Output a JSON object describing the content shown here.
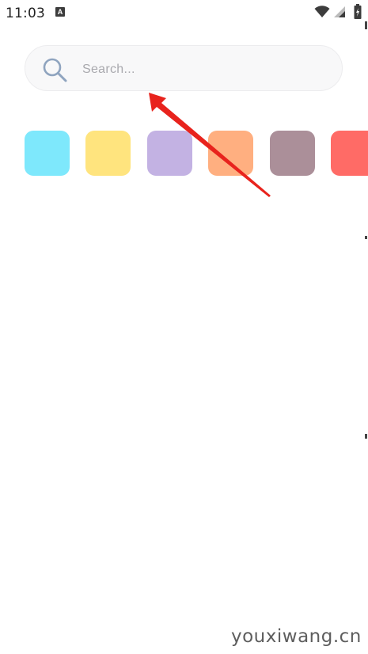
{
  "status_bar": {
    "time": "11:03",
    "notification_badge": "A",
    "icons": [
      "notification-a-icon",
      "wifi-icon",
      "signal-icon",
      "battery-icon"
    ]
  },
  "search": {
    "placeholder": "Search...",
    "value": "",
    "icon": "search-icon",
    "icon_color": "#8fa4bf"
  },
  "swatches": {
    "colors": [
      "#7ee8fc",
      "#ffe47e",
      "#c3b2e3",
      "#ffaf80",
      "#ab8f99",
      "#ff6b66"
    ]
  },
  "annotation": {
    "color": "#e8231d",
    "icon": "red-arrow-icon"
  },
  "watermark": {
    "text": "youxiwang.cn"
  }
}
